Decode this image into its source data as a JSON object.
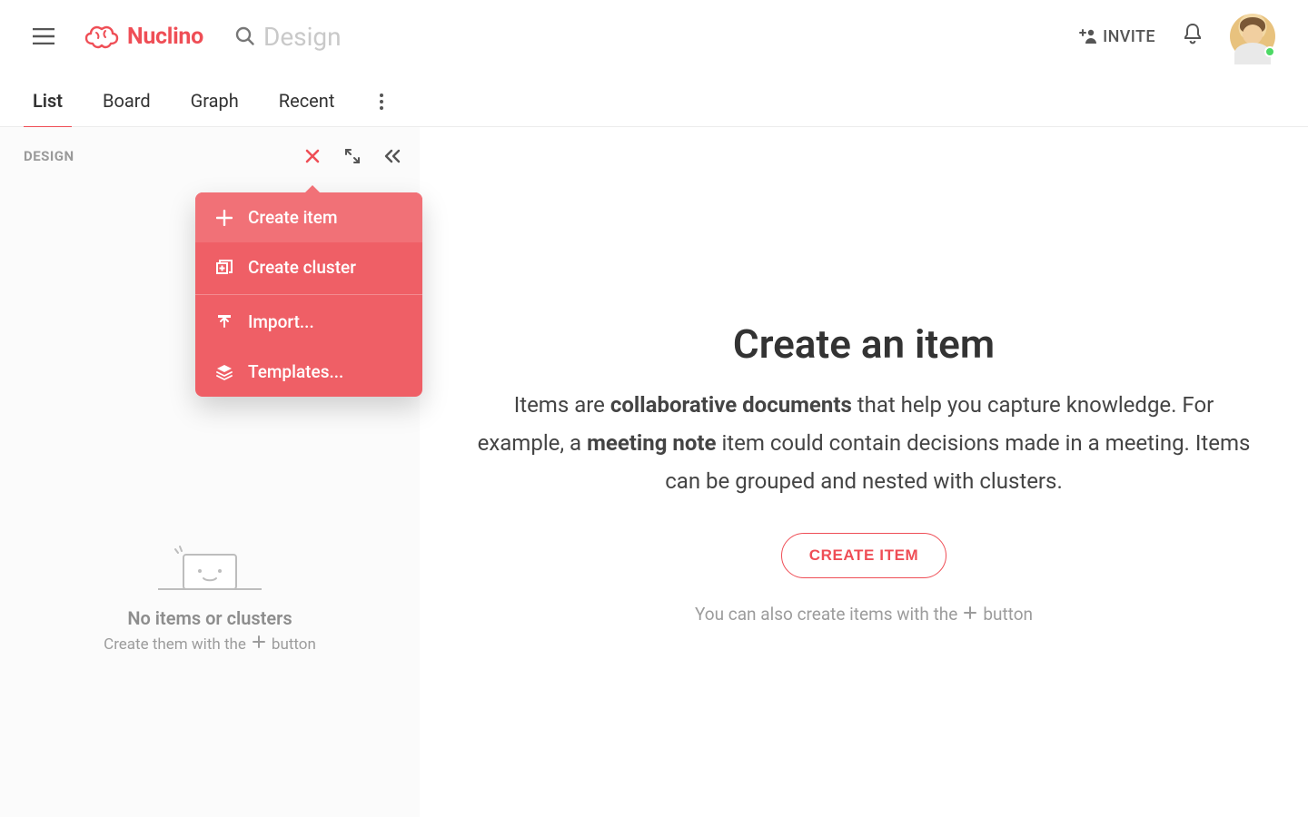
{
  "brand": {
    "name": "Nuclino"
  },
  "colors": {
    "accent": "#ef4e56",
    "presence": "#4cd964"
  },
  "header": {
    "search_placeholder": "Design",
    "invite_label": "INVITE"
  },
  "tabs": [
    {
      "label": "List",
      "active": true
    },
    {
      "label": "Board",
      "active": false
    },
    {
      "label": "Graph",
      "active": false
    },
    {
      "label": "Recent",
      "active": false
    }
  ],
  "sidebar": {
    "title": "DESIGN",
    "dropdown": {
      "create_item": "Create item",
      "create_cluster": "Create cluster",
      "import": "Import...",
      "templates": "Templates..."
    },
    "empty": {
      "title": "No items or clusters",
      "subtitle_prefix": "Create them with the",
      "subtitle_suffix": "button"
    }
  },
  "main": {
    "title": "Create an item",
    "desc_parts": {
      "p1": "Items are ",
      "b1": "collaborative documents",
      "p2": " that help you capture knowledge. For example, a ",
      "b2": "meeting note",
      "p3": " item could contain decisions made in a meeting. Items can be grouped and nested with clusters."
    },
    "create_button": "CREATE ITEM",
    "hint_prefix": "You can also create items with the",
    "hint_suffix": "button"
  }
}
